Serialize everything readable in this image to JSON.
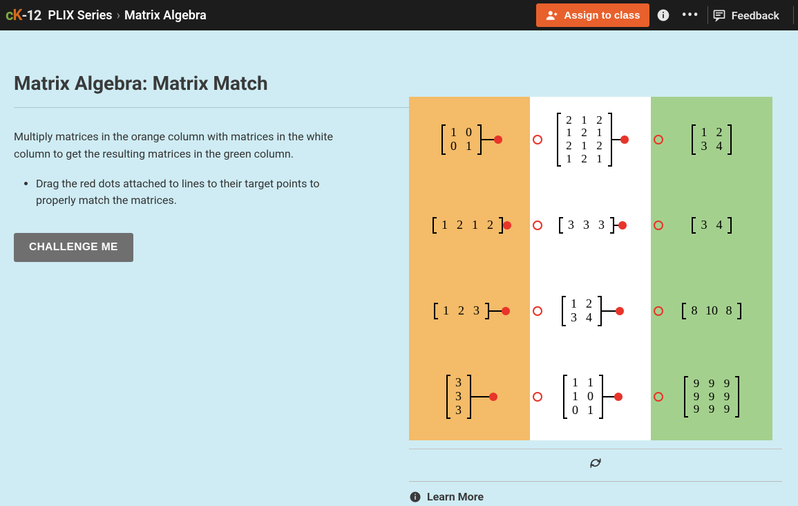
{
  "header": {
    "logo_parts": {
      "c": "c",
      "k": "K",
      "dash": "-",
      "twelve": "12"
    },
    "crumb1": "PLIX Series",
    "sep": "›",
    "crumb2": "Matrix Algebra",
    "assign_label": "Assign to class",
    "feedback_label": "Feedback"
  },
  "left": {
    "title": "Matrix Algebra: Matrix Match",
    "para": "Multiply matrices in the orange column with matrices in the white column to get the resulting matrices in the green column.",
    "bullet": "Drag the red dots attached to lines to their target points to properly match the matrices.",
    "challenge_label": "CHALLENGE ME"
  },
  "board": {
    "orange": [
      [
        [
          "1",
          "0"
        ],
        [
          "0",
          "1"
        ]
      ],
      [
        [
          "1",
          "2",
          "1",
          "2"
        ]
      ],
      [
        [
          "1",
          "2",
          "3"
        ]
      ],
      [
        [
          "3"
        ],
        [
          "3"
        ],
        [
          "3"
        ]
      ]
    ],
    "white": [
      [
        [
          "2",
          "1",
          "2"
        ],
        [
          "1",
          "2",
          "1"
        ],
        [
          "2",
          "1",
          "2"
        ],
        [
          "1",
          "2",
          "1"
        ]
      ],
      [
        [
          "3",
          "3",
          "3"
        ]
      ],
      [
        [
          "1",
          "2"
        ],
        [
          "3",
          "4"
        ]
      ],
      [
        [
          "1",
          "1"
        ],
        [
          "1",
          "0"
        ],
        [
          "0",
          "1"
        ]
      ]
    ],
    "green": [
      [
        [
          "1",
          "2"
        ],
        [
          "3",
          "4"
        ]
      ],
      [
        [
          "3",
          "4"
        ]
      ],
      [
        [
          "8",
          "10",
          "8"
        ]
      ],
      [
        [
          "9",
          "9",
          "9"
        ],
        [
          "9",
          "9",
          "9"
        ],
        [
          "9",
          "9",
          "9"
        ]
      ]
    ]
  },
  "footer": {
    "learn_more": "Learn More"
  }
}
